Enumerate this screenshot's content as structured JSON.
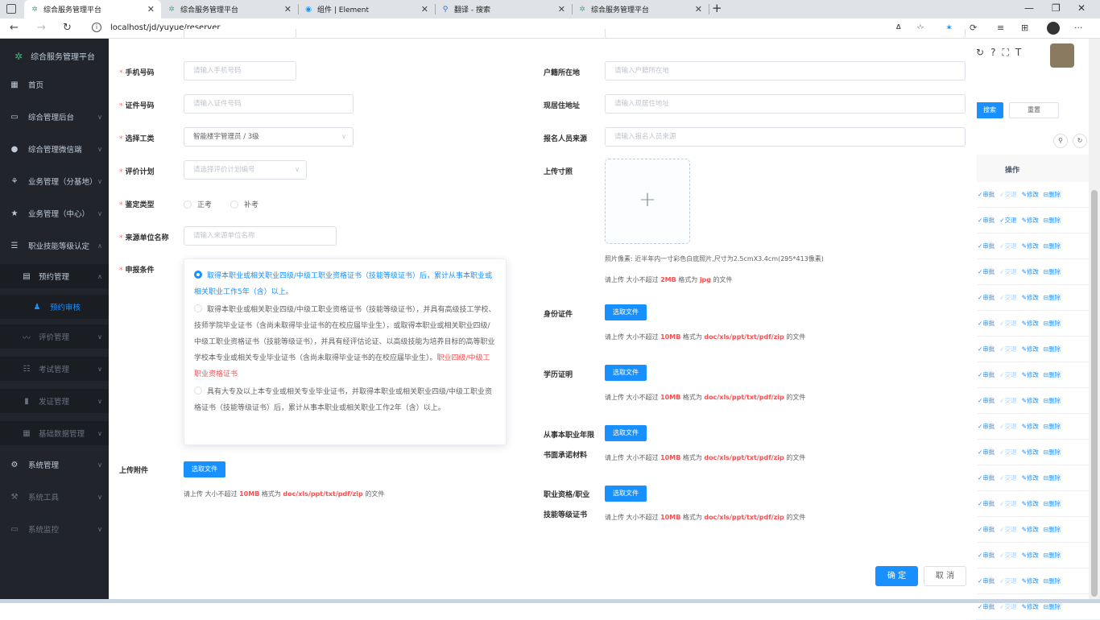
{
  "browser": {
    "tabs": [
      {
        "label": "综合服务管理平台",
        "icon": "leaf-icon",
        "active": true
      },
      {
        "label": "综合服务管理平台",
        "icon": "leaf-icon",
        "active": false
      },
      {
        "label": "组件 | Element",
        "icon": "element-icon",
        "active": false
      },
      {
        "label": "翻译 - 搜索",
        "icon": "search-icon",
        "active": false
      },
      {
        "label": "综合服务管理平台",
        "icon": "leaf-icon",
        "active": false
      }
    ],
    "url": "localhost/jd/yuyue/reserver"
  },
  "sidebar": {
    "brand": "综合服务管理平台",
    "items": [
      {
        "label": "首页",
        "icon": "dashboard-icon"
      },
      {
        "label": "综合管理后台",
        "icon": "monitor-icon"
      },
      {
        "label": "综合管理微信端",
        "icon": "wechat-icon"
      },
      {
        "label": "业务管理（分基地）",
        "icon": "tree-icon"
      },
      {
        "label": "业务管理（中心）",
        "icon": "star-icon"
      },
      {
        "label": "职业技能等级认定",
        "icon": "list-icon"
      },
      {
        "label": "预约管理",
        "icon": "document-icon"
      },
      {
        "label": "预约审核",
        "icon": "user-icon"
      },
      {
        "label": "评价管理",
        "icon": "chart-icon"
      },
      {
        "label": "考试管理",
        "icon": "list-icon"
      },
      {
        "label": "发证管理",
        "icon": "certificate-icon"
      },
      {
        "label": "基础数据管理",
        "icon": "grid-icon"
      },
      {
        "label": "系统管理",
        "icon": "gear-icon"
      },
      {
        "label": "系统工具",
        "icon": "tool-icon"
      },
      {
        "label": "系统监控",
        "icon": "monitor-icon"
      }
    ]
  },
  "background": {
    "search_btn": "搜索",
    "reset_btn": "重置",
    "col_action": "操作",
    "row_actions": [
      "审批",
      "交退",
      "修改",
      "删除"
    ]
  },
  "form": {
    "phone": {
      "label": "手机号码",
      "placeholder": "请输入手机号码"
    },
    "id_no": {
      "label": "证件号码",
      "placeholder": "请输入证件号码"
    },
    "job_type": {
      "label": "选择工类",
      "value": "智能楼宇管理员 / 3级"
    },
    "eval_plan": {
      "label": "评价计划",
      "placeholder": "请选择评价计划编号"
    },
    "exam_type": {
      "label": "鉴定类型",
      "opt1": "正考",
      "opt2": "补考"
    },
    "source_unit": {
      "label": "来源单位名称",
      "placeholder": "请输入来源单位名称"
    },
    "conditions": {
      "label": "申报条件",
      "c1": "取得本职业或相关职业四级/中级工职业资格证书（技能等级证书）后，累计从事本职业或相关职业工作5年（含）以上。",
      "c2_main": "取得本职业或相关职业四级/中级工职业资格证书（技能等级证书），并具有高级技工学校、技师学院毕业证书（含尚未取得毕业证书的在校应届毕业生），或取得本职业或相关职业四级/中级工职业资格证书（技能等级证书），并具有经评估论证、以高级技能为培养目标的高等职业学校本专业或相关专业毕业证书（含尚未取得毕业证书的在校应届毕业生）。",
      "c2_highlight": "职业四级/中级工职业资格证书",
      "c3": "具有大专及以上本专业或相关专业毕业证书，并取得本职业或相关职业四级/中级工职业资格证书（技能等级证书）后，累计从事本职业或相关职业工作2年（含）以上。"
    },
    "attachment": {
      "label": "上传附件",
      "btn": "选取文件",
      "tip_pre": "请上传 大小不超过 ",
      "tip_size": "10MB",
      "tip_mid": " 格式为 ",
      "tip_fmt": "doc/xls/ppt/txt/pdf/zip",
      "tip_post": " 的文件"
    },
    "household": {
      "label": "户籍所在地",
      "placeholder": "请输入户籍所在地"
    },
    "address": {
      "label": "现居住地址",
      "placeholder": "请输入现居住地址"
    },
    "applicant_source": {
      "label": "报名人员来源",
      "placeholder": "请输入报名人员来源"
    },
    "photo": {
      "label": "上传寸照",
      "plus": "+",
      "hint": "照片像素: 近半年内一寸彩色白底照片,尺寸为2.5cmX3.4cm(295*413像素)",
      "tip_pre": "请上传 大小不超过 ",
      "tip_size": "2MB",
      "tip_mid": " 格式为 ",
      "tip_fmt": "jpg",
      "tip_post": " 的文件"
    },
    "id_cert": {
      "label": "身份证件",
      "btn": "选取文件"
    },
    "edu_cert": {
      "label": "学历证明",
      "btn": "选取文件"
    },
    "work_years": {
      "label1": "从事本职业年限",
      "label2": "书面承诺材料",
      "btn": "选取文件"
    },
    "qual_cert": {
      "label1": "职业资格/职业",
      "label2": "技能等级证书",
      "btn": "选取文件"
    },
    "file_tip": {
      "pre": "请上传 大小不超过 ",
      "size": "10MB",
      "mid": " 格式为 ",
      "fmt": "doc/xls/ppt/txt/pdf/zip",
      "post": " 的文件"
    },
    "ok_btn": "确 定",
    "cancel_btn": "取 消"
  },
  "colors": {
    "primary": "#1890ff",
    "danger": "#ff4d4f",
    "sidebar": "#21252b"
  }
}
